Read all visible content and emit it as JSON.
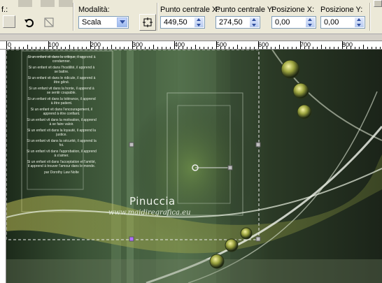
{
  "toolbar": {
    "left_label": "f.:",
    "mode_label": "Modalità:",
    "mode_value": "Scala",
    "center_x_label": "Punto centrale X:",
    "center_x_value": "449,50",
    "center_y_label": "Punto centrale Y:",
    "center_y_value": "274,50",
    "pos_x_label": "Posizione X:",
    "pos_x_value": "0,00",
    "pos_y_label": "Posizione Y:",
    "pos_y_value": "0,00"
  },
  "ruler": {
    "labels": [
      "0",
      "100",
      "200",
      "300",
      "400",
      "500",
      "600",
      "700",
      "800"
    ]
  },
  "canvas": {
    "signature": "Pinuccia",
    "website": "www.maidiregrafica.eu",
    "poem_lines": [
      "Si un enfant vit dans la critique, il apprend à condamner.",
      "Si un enfant vit dans l'hostilité, il apprend à se battre.",
      "Si un enfant vit dans le ridicule, il apprend à être gêné.",
      "Si un enfant vit dans la honte, il apprend à se sentir coupable.",
      "Si un enfant vit dans la tolérance, il apprend à être patient.",
      "Si un enfant vit dans l'encouragement, il apprend à être confiant.",
      "Si un enfant vit dans la motivation, il apprend à se faire valoir.",
      "Si un enfant vit dans la loyauté, il apprend la justice.",
      "Si un enfant vit dans la sécurité, il apprend la foi.",
      "Si un enfant vit dans l'approbation, il apprend à s'aimer.",
      "Si un enfant vit dans l'acceptation et l'amitié, il apprend à trouver l'amour dans le monde.",
      "par Dorothy Law Nolte"
    ]
  },
  "colors": {
    "toolbar_bg": "#ece9d8",
    "canvas_dark": "#1c2a1a",
    "canvas_green": "#526f4b",
    "accent_yellow": "#c9c85a"
  }
}
